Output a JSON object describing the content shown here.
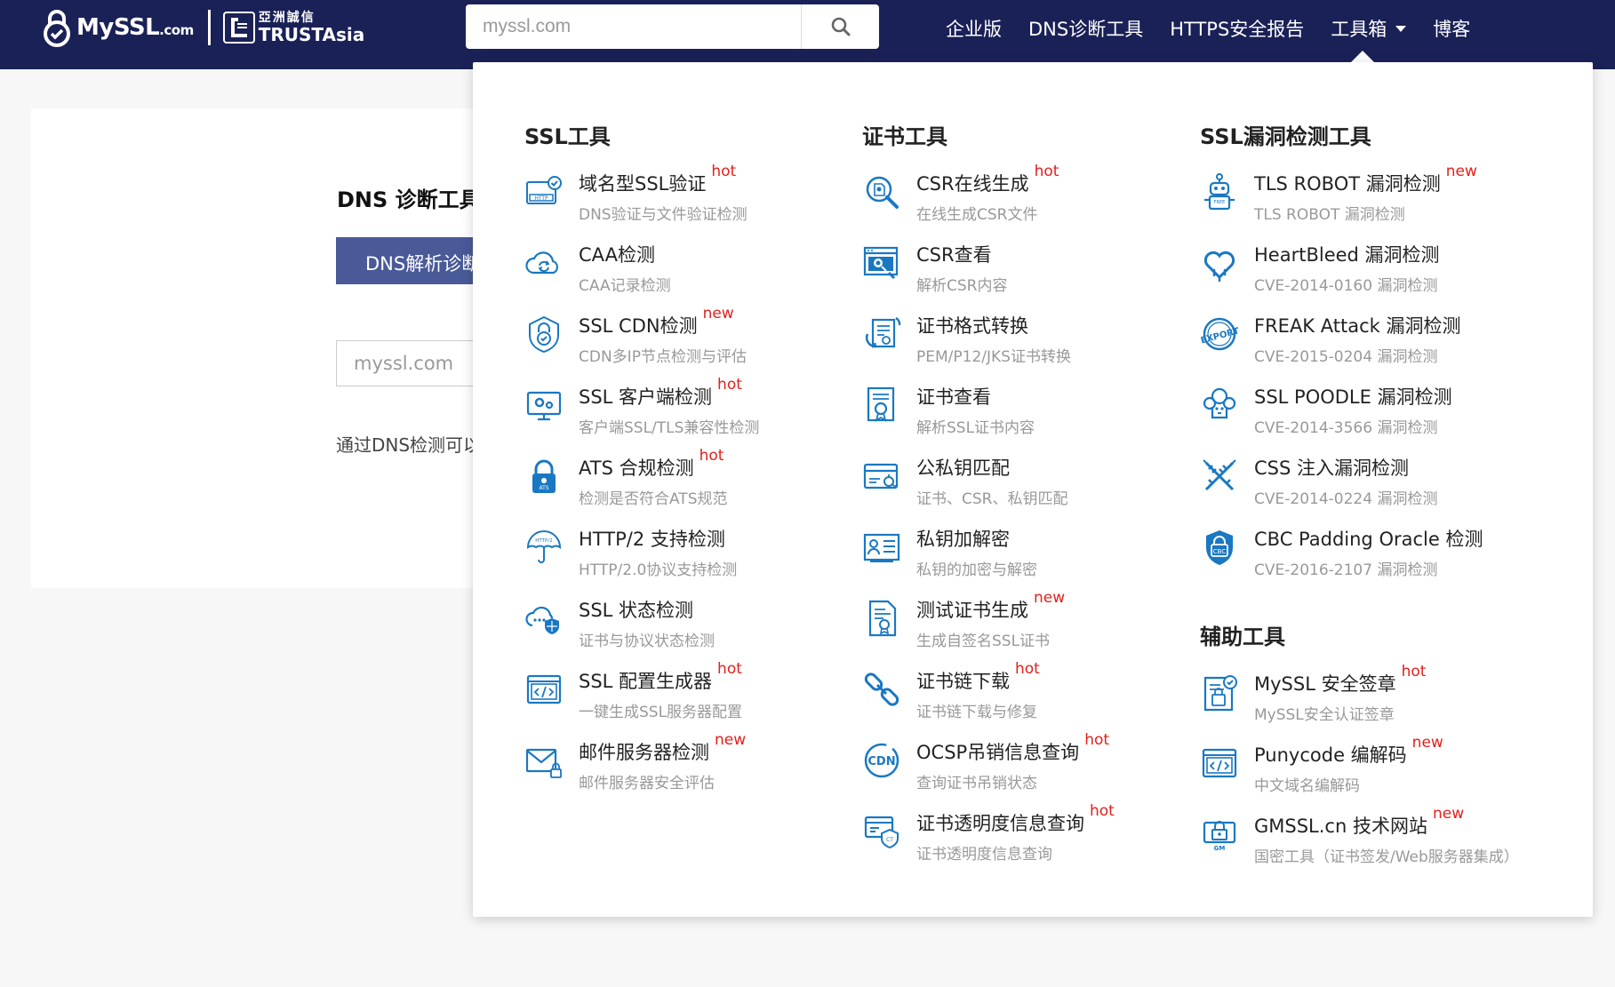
{
  "header": {
    "logo_text": "MySSL",
    "logo_suffix": ".com",
    "partner_cn": "亞洲誠信",
    "partner_en": "TRUSTAsia",
    "search_placeholder": "myssl.com",
    "nav": [
      "企业版",
      "DNS诊断工具",
      "HTTPS安全报告",
      "工具箱",
      "博客"
    ]
  },
  "background_page": {
    "title": "DNS 诊断工具",
    "tab": "DNS解析诊断",
    "input_placeholder": "myssl.com",
    "desc": "通过DNS检测可以"
  },
  "menu": {
    "columns": [
      {
        "heading": "SSL工具",
        "items": [
          {
            "name": "域名型SSL验证",
            "tag": "hot",
            "desc": "DNS验证与文件验证检测",
            "icon": "http-icon"
          },
          {
            "name": "CAA检测",
            "tag": "",
            "desc": "CAA记录检测",
            "icon": "cloud-sync-icon"
          },
          {
            "name": "SSL CDN检测",
            "tag": "new",
            "desc": "CDN多IP节点检测与评估",
            "icon": "lock-badge-icon"
          },
          {
            "name": "SSL 客户端检测",
            "tag": "hot",
            "desc": "客户端SSL/TLS兼容性检测",
            "icon": "monitor-gear-icon"
          },
          {
            "name": "ATS 合规检测",
            "tag": "hot",
            "desc": "检测是否符合ATS规范",
            "icon": "ats-lock-icon"
          },
          {
            "name": "HTTP/2 支持检测",
            "tag": "",
            "desc": "HTTP/2.0协议支持检测",
            "icon": "umbrella-icon"
          },
          {
            "name": "SSL 状态检测",
            "tag": "",
            "desc": "证书与协议状态检测",
            "icon": "cloud-shield-icon"
          },
          {
            "name": "SSL 配置生成器",
            "tag": "hot",
            "desc": "一键生成SSL服务器配置",
            "icon": "code-window-icon"
          },
          {
            "name": "邮件服务器检测",
            "tag": "new",
            "desc": "邮件服务器安全评估",
            "icon": "mail-lock-icon"
          }
        ]
      },
      {
        "heading": "证书工具",
        "items": [
          {
            "name": "CSR在线生成",
            "tag": "hot",
            "desc": "在线生成CSR文件",
            "icon": "magnifier-doc-icon"
          },
          {
            "name": "CSR查看",
            "tag": "",
            "desc": "解析CSR内容",
            "icon": "inspect-window-icon"
          },
          {
            "name": "证书格式转换",
            "tag": "",
            "desc": "PEM/P12/JKS证书转换",
            "icon": "convert-cert-icon"
          },
          {
            "name": "证书查看",
            "tag": "",
            "desc": "解析SSL证书内容",
            "icon": "cert-search-icon"
          },
          {
            "name": "公私钥匹配",
            "tag": "",
            "desc": "证书、CSR、私钥匹配",
            "icon": "key-card-icon"
          },
          {
            "name": "私钥加解密",
            "tag": "",
            "desc": "私钥的加密与解密",
            "icon": "id-card-icon"
          },
          {
            "name": "测试证书生成",
            "tag": "new",
            "desc": "生成自签名SSL证书",
            "icon": "cert-doc-icon"
          },
          {
            "name": "证书链下载",
            "tag": "hot",
            "desc": "证书链下载与修复",
            "icon": "chain-icon"
          },
          {
            "name": "OCSP吊销信息查询",
            "tag": "hot",
            "desc": "查询证书吊销状态",
            "icon": "cdn-icon"
          },
          {
            "name": "证书透明度信息查询",
            "tag": "hot",
            "desc": "证书透明度信息查询",
            "icon": "ct-card-icon"
          }
        ]
      },
      {
        "heading": "SSL漏洞检测工具",
        "items": [
          {
            "name": "TLS ROBOT 漏洞检测",
            "tag": "new",
            "desc": "TLS ROBOT 漏洞检测",
            "icon": "robot-icon"
          },
          {
            "name": "HeartBleed 漏洞检测",
            "tag": "",
            "desc": "CVE-2014-0160 漏洞检测",
            "icon": "bleeding-heart-icon"
          },
          {
            "name": "FREAK Attack 漏洞检测",
            "tag": "",
            "desc": "CVE-2015-0204 漏洞检测",
            "icon": "export-stamp-icon"
          },
          {
            "name": "SSL POODLE 漏洞检测",
            "tag": "",
            "desc": "CVE-2014-3566 漏洞检测",
            "icon": "poodle-icon"
          },
          {
            "name": "CSS 注入漏洞检测",
            "tag": "",
            "desc": "CVE-2014-0224 漏洞检测",
            "icon": "syringe-icon"
          },
          {
            "name": "CBC Padding Oracle 检测",
            "tag": "",
            "desc": "CVE-2016-2107 漏洞检测",
            "icon": "cbc-lock-icon"
          }
        ]
      },
      {
        "heading": "辅助工具",
        "items": [
          {
            "name": "MySSL 安全签章",
            "tag": "hot",
            "desc": "MySSL安全认证签章",
            "icon": "seal-doc-icon"
          },
          {
            "name": "Punycode 编解码",
            "tag": "new",
            "desc": "中文域名编解码",
            "icon": "code-window-icon"
          },
          {
            "name": "GMSSL.cn 技术网站",
            "tag": "new",
            "desc": "国密工具（证书签发/Web服务器集成）",
            "icon": "gm-lock-icon"
          }
        ]
      }
    ]
  },
  "colors": {
    "navbar": "#1a2157",
    "icon": "#1a78c2",
    "tag": "#e3201b",
    "tab": "#4a5a98"
  }
}
